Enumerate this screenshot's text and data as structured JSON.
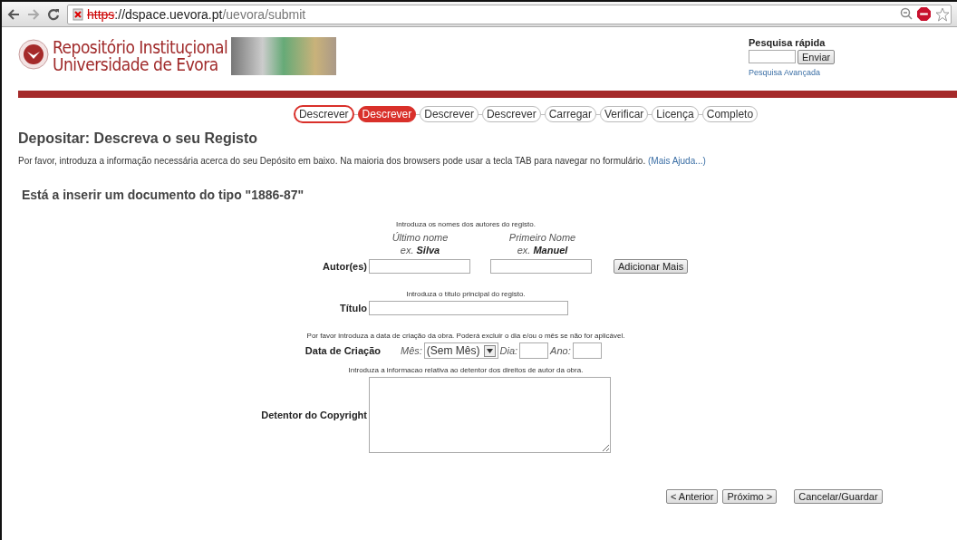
{
  "browser": {
    "url_scheme": "https",
    "url_separator": "://",
    "url_host": "dspace.uevora.pt",
    "url_path": "/uevora/submit",
    "secure": false
  },
  "header": {
    "logo_line1": "Repositório Instituçional",
    "logo_line2": "Universidade de Evora"
  },
  "quick_search": {
    "title": "Pesquisa rápida",
    "button": "Enviar",
    "link": "Pesquisa Avançada"
  },
  "steps": [
    {
      "label": "Descrever",
      "completed": true,
      "selected": false
    },
    {
      "label": "Descrever",
      "completed": false,
      "selected": true
    },
    {
      "label": "Descrever",
      "completed": false,
      "selected": false
    },
    {
      "label": "Descrever",
      "completed": false,
      "selected": false
    },
    {
      "label": "Carregar",
      "completed": false,
      "selected": false
    },
    {
      "label": "Verificar",
      "completed": false,
      "selected": false
    },
    {
      "label": "Licença",
      "completed": false,
      "selected": false
    },
    {
      "label": "Completo",
      "completed": false,
      "selected": false
    }
  ],
  "heading": "Depositar: Descreva o seu Registo",
  "intro": {
    "text": "Por favor, introduza a informação necessária acerca do seu Depósito em baixo. Na maioria dos browsers pode usar a tecla TAB para navegar no formulário.",
    "link": "(Mais Ajuda...)"
  },
  "doc_type": "Está a inserir um documento do tipo \"1886-87\"",
  "authors": {
    "hint": "Introduza os nomes dos autores do registo.",
    "last_name_label": "Último nome",
    "last_name_example": "ex. **Silva**",
    "first_name_label": "Primeiro Nome",
    "first_name_example": "ex. **Manuel**",
    "label": "Autor(es)",
    "button": "Adicionar Mais"
  },
  "title_field": {
    "hint": "Introduza o título principal do registo.",
    "label": "Título"
  },
  "date": {
    "hint": "Por favor introduza a data de criação da obra. Poderá excluir o dia e/ou o mês se não for aplicável.",
    "label": "Data de Criação",
    "month_label": "Mês:",
    "month_value": "(Sem Mês)",
    "day_label": "Dia:",
    "year_label": "Ano:"
  },
  "copyright": {
    "hint": "Introduza a informacao relativa ao detentor dos direitos de autor da obra.",
    "label": "Detentor do Copyright"
  },
  "buttons": [
    "< Anterior",
    "Próximo >",
    "Cancelar/Guardar"
  ]
}
